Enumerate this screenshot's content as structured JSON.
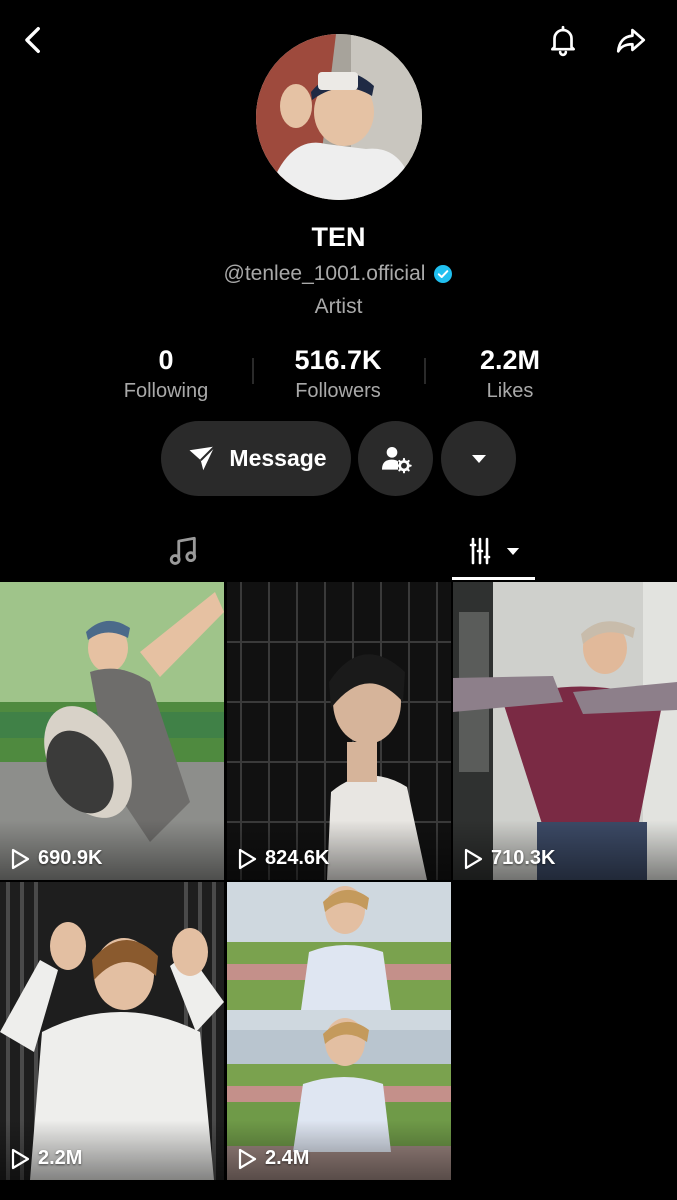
{
  "profile": {
    "name": "TEN",
    "handle": "@tenlee_1001.official",
    "bio": "Artist"
  },
  "stats": {
    "following": {
      "value": "0",
      "label": "Following"
    },
    "followers": {
      "value": "516.7K",
      "label": "Followers"
    },
    "likes": {
      "value": "2.2M",
      "label": "Likes"
    }
  },
  "actions": {
    "message_label": "Message"
  },
  "icons": {
    "back": "chevron-left-icon",
    "notifications": "bell-icon",
    "share": "share-arrow-icon",
    "message": "paper-plane-icon",
    "add_friend": "user-gear-icon",
    "more": "caret-down-icon",
    "music_tab": "music-note-icon",
    "videos_tab": "grid-bars-icon"
  },
  "colors": {
    "background": "#000000",
    "button_bg": "#2a2a2a",
    "secondary_text": "#a9a9a9",
    "verified": "#20c0f0"
  },
  "videos": [
    {
      "views": "690.9K"
    },
    {
      "views": "824.6K"
    },
    {
      "views": "710.3K"
    },
    {
      "views": "2.2M"
    },
    {
      "views": "2.4M"
    }
  ]
}
